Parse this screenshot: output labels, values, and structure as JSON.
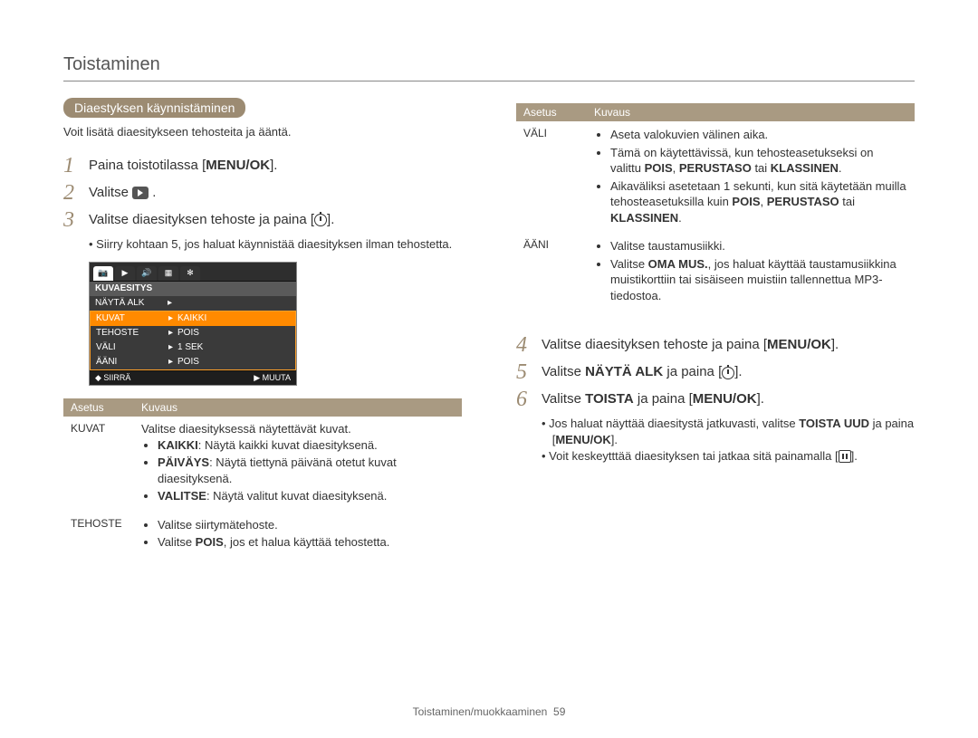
{
  "page": {
    "title": "Toistaminen",
    "footer_section": "Toistaminen/muokkaaminen",
    "footer_page": "59"
  },
  "left": {
    "heading_pill": "Diaestyksen käynnistäminen",
    "intro": "Voit lisätä diaesitykseen tehosteita ja ääntä.",
    "step1": {
      "text_a": "Paina toistotilassa [",
      "bold": "MENU/OK",
      "text_b": "]."
    },
    "step2": {
      "text_a": "Valitse "
    },
    "step3": {
      "text_a": "Valitse diaesityksen tehoste ja paina [",
      "text_b": "].",
      "note": "Siirry kohtaan 5, jos haluat käynnistää diaesityksen ilman tehostetta."
    },
    "menu": {
      "tab_labels": [
        "📷",
        "▶",
        "🔊",
        "▦",
        "✻"
      ],
      "header_row": "KUVAESITYS",
      "row1": "NÄYTÄ ALK",
      "row2_l": "KUVAT",
      "row2_r": "KAIKKI",
      "row3_l": "TEHOSTE",
      "row3_r": "POIS",
      "row4_l": "VÄLI",
      "row4_r": "1 SEK",
      "row5_l": "ÄÄNI",
      "row5_r": "POIS",
      "footer_l": "SIIRRÄ",
      "footer_r": "MUUTA"
    },
    "table": {
      "h1": "Asetus",
      "h2": "Kuvaus",
      "r1_name": "KUVAT",
      "r1_intro": "Valitse diaesityksessä näytettävät kuvat.",
      "r1_b1_bold": "KAIKKI",
      "r1_b1_rest": ": Näytä kaikki kuvat diaesityksenä.",
      "r1_b2_bold": "PÄIVÄYS",
      "r1_b2_rest": ": Näytä tiettynä päivänä otetut kuvat diaesityksenä.",
      "r1_b3_bold": "VALITSE",
      "r1_b3_rest": ": Näytä valitut kuvat diaesityksenä.",
      "r2_name": "TEHOSTE",
      "r2_b1": "Valitse siirtymätehoste.",
      "r2_b2_a": "Valitse ",
      "r2_b2_bold": "POIS",
      "r2_b2_b": ", jos et halua käyttää tehostetta."
    }
  },
  "right": {
    "table": {
      "h1": "Asetus",
      "h2": "Kuvaus",
      "r1_name": "VÄLI",
      "r1_b1": "Aseta valokuvien välinen aika.",
      "r1_b2_a": "Tämä on käytettävissä, kun tehosteasetukseksi on valittu ",
      "r1_b2_bold1": "POIS",
      "r1_b2_sep": ", ",
      "r1_b2_bold2": "PERUSTASO",
      "r1_b2_or": " tai ",
      "r1_b2_bold3": "KLASSINEN",
      "r1_b2_end": ".",
      "r1_b3_a": "Aikaväliksi asetetaan 1 sekunti, kun sitä käytetään muilla tehosteasetuksilla kuin ",
      "r1_b3_bold1": "POIS",
      "r1_b3_sep": ", ",
      "r1_b3_bold2": "PERUSTASO",
      "r1_b3_or": " tai ",
      "r1_b3_bold3": "KLASSINEN",
      "r1_b3_end": ".",
      "r2_name": "ÄÄNI",
      "r2_b1": "Valitse taustamusiikki.",
      "r2_b2_a": "Valitse ",
      "r2_b2_bold": "OMA MUS.",
      "r2_b2_b": ", jos haluat käyttää taustamusiikkina muistikorttiin tai sisäiseen muistiin tallennettua MP3-tiedostoa."
    },
    "step4": {
      "text_a": "Valitse diaesityksen tehoste ja paina [",
      "bold": "MENU/OK",
      "text_b": "]."
    },
    "step5": {
      "text_a": "Valitse ",
      "bold": "NÄYTÄ ALK",
      "text_b": " ja paina [",
      "text_c": "]."
    },
    "step6": {
      "text_a": "Valitse ",
      "bold": "TOISTA",
      "text_b": " ja paina [",
      "bold2": "MENU/OK",
      "text_c": "].",
      "note1_a": "Jos haluat näyttää diaesitystä jatkuvasti, valitse ",
      "note1_bold": "TOISTA UUD",
      "note1_b": " ja paina [",
      "note1_bold2": "MENU/OK",
      "note1_c": "].",
      "note2": "Voit keskeytttää diaesityksen tai jatkaa sitä painamalla [",
      "note2_end": "]."
    }
  }
}
